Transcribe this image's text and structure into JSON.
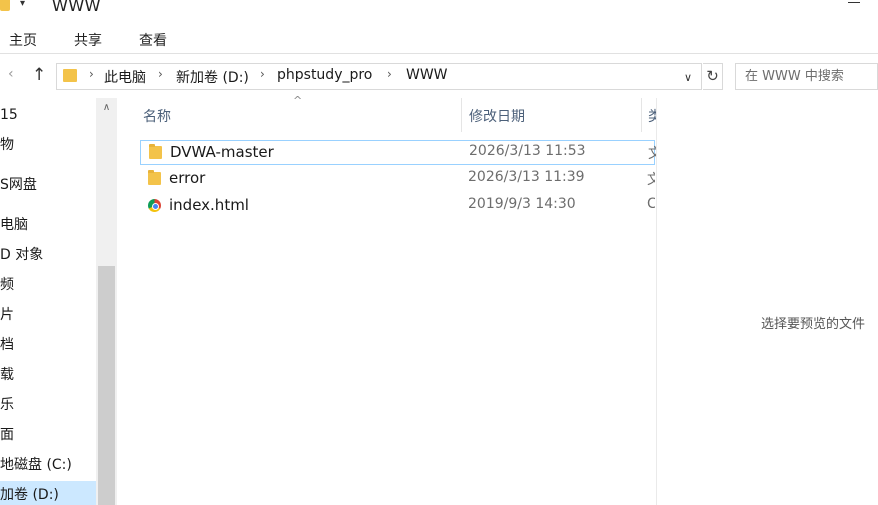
{
  "window": {
    "title": "WWW"
  },
  "ribbon": {
    "tabs": [
      "主页",
      "共享",
      "查看"
    ]
  },
  "nav": {
    "back": "‹",
    "up": "↑"
  },
  "address": {
    "crumbs": [
      "此电脑",
      "新加卷 (D:)",
      "phpstudy_pro",
      "WWW"
    ],
    "separator": "›",
    "dropdown": "∨",
    "refresh": "↻"
  },
  "search": {
    "placeholder": "在 WWW 中搜索"
  },
  "navpane": {
    "scroll_up": "∧",
    "items": [
      {
        "label": "15",
        "selected": false
      },
      {
        "label": "物",
        "selected": false
      },
      {
        "label": "S网盘",
        "selected": false
      },
      {
        "label": "电脑",
        "selected": false
      },
      {
        "label": "D 对象",
        "selected": false
      },
      {
        "label": "频",
        "selected": false
      },
      {
        "label": "片",
        "selected": false
      },
      {
        "label": "档",
        "selected": false
      },
      {
        "label": "载",
        "selected": false
      },
      {
        "label": "乐",
        "selected": false
      },
      {
        "label": "面",
        "selected": false
      },
      {
        "label": "地磁盘 (C:)",
        "selected": false
      },
      {
        "label": "加卷 (D:)",
        "selected": true
      }
    ]
  },
  "filelist": {
    "sort_indicator": "^",
    "columns": {
      "name": "名称",
      "date": "修改日期",
      "type": "类"
    },
    "rows": [
      {
        "icon": "folder-icon",
        "name": "DVWA-master",
        "date": "2026/3/13 11:53",
        "type": "文",
        "focused": true
      },
      {
        "icon": "folder-icon",
        "name": "error",
        "date": "2026/3/13 11:39",
        "type": "文",
        "focused": false
      },
      {
        "icon": "chrome-html-icon",
        "name": "index.html",
        "date": "2019/9/3 14:30",
        "type": "C",
        "focused": false
      }
    ]
  },
  "preview": {
    "message": "选择要预览的文件"
  }
}
